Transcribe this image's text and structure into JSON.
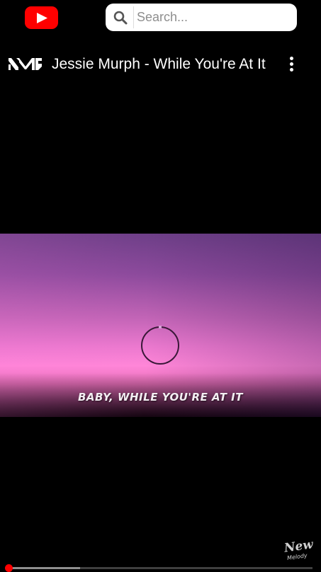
{
  "header": {
    "logo_icon": "youtube-icon",
    "search": {
      "placeholder": "Search...",
      "value": "",
      "icon": "search-icon"
    }
  },
  "video": {
    "channel_logo_icon": "channel-logo-icon",
    "title": "Jessie Murph - While You're At It",
    "more_icon": "more-vert-icon",
    "lyric_caption": "BABY, WHILE YOU'RE AT IT",
    "status_icon": "loading-spinner-icon",
    "watermark": {
      "top": "New",
      "bottom": "Melody"
    }
  },
  "player": {
    "progress_fraction": 0.0,
    "buffered_fraction": 0.235
  },
  "colors": {
    "accent": "#ff0000",
    "background": "#000000",
    "search_bg": "#ffffff"
  }
}
